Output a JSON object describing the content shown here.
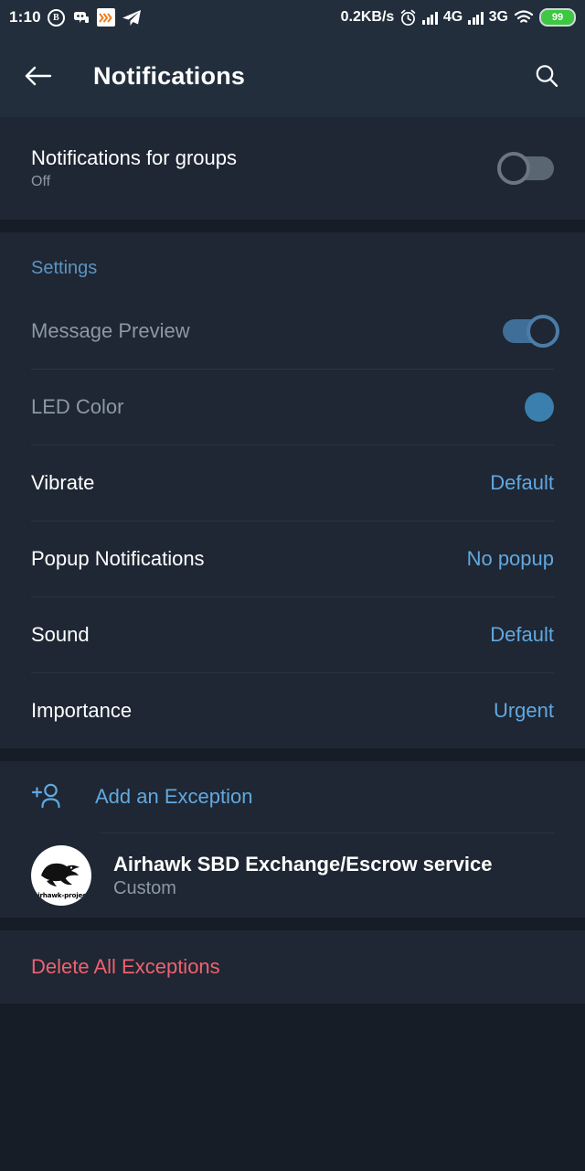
{
  "statusbar": {
    "time": "1:10",
    "business_badge": "B",
    "chevrons": "»›",
    "net_speed": "0.2KB/s",
    "network_1": "4G",
    "network_2": "3G",
    "battery_level": "99",
    "battery_color": "#3ec740",
    "icons": [
      "whatsapp-business-icon",
      "discord-icon",
      "chevrons-icon",
      "telegram-icon",
      "alarm-icon",
      "signal-icon",
      "wifi-icon",
      "battery-icon"
    ]
  },
  "appbar": {
    "back_label": "Back",
    "title": "Notifications",
    "search_label": "Search"
  },
  "groups_section": {
    "title": "Notifications for groups",
    "subtitle": "Off",
    "toggle_state": "off"
  },
  "settings_section": {
    "header": "Settings",
    "rows": [
      {
        "label": "Message Preview",
        "control": "toggle",
        "state": "on",
        "disabled": true
      },
      {
        "label": "LED Color",
        "control": "swatch",
        "color": "#3a7fad",
        "disabled": true
      },
      {
        "label": "Vibrate",
        "control": "value",
        "value": "Default",
        "disabled": false
      },
      {
        "label": "Popup Notifications",
        "control": "value",
        "value": "No popup",
        "disabled": false
      },
      {
        "label": "Sound",
        "control": "value",
        "value": "Default",
        "disabled": false
      },
      {
        "label": "Importance",
        "control": "value",
        "value": "Urgent",
        "disabled": false
      }
    ]
  },
  "exceptions_section": {
    "add_label": "Add an Exception",
    "contact": {
      "name": "Airhawk SBD Exchange/Escrow service",
      "subtitle": "Custom",
      "avatar_text": "airhawk-project"
    }
  },
  "delete_section": {
    "label": "Delete All Exceptions",
    "color": "#f0616f"
  },
  "theme": {
    "page_bg": "#161d26",
    "card_bg": "#1e2733",
    "appbar_bg": "#222e3c",
    "accent": "#62a8e0",
    "muted": "#8c98a6",
    "danger": "#f0616f"
  }
}
